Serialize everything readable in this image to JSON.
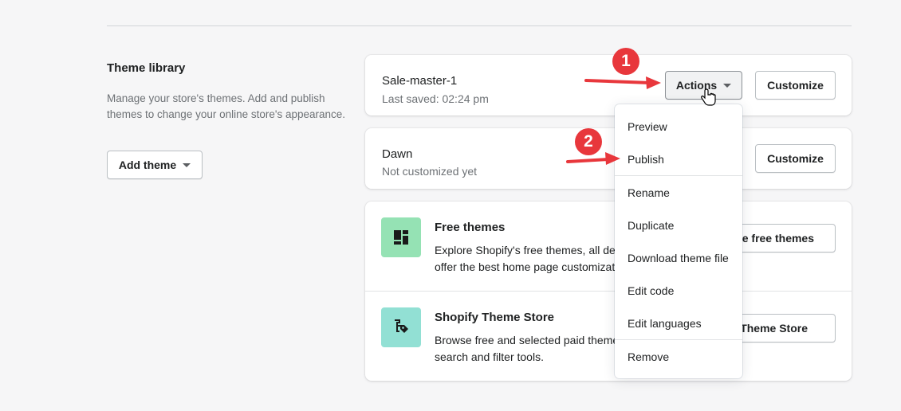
{
  "library": {
    "title": "Theme library",
    "description": "Manage your store's themes. Add and publish themes to change your online store's appearance.",
    "add_theme_label": "Add theme"
  },
  "themes": [
    {
      "name": "Sale-master-1",
      "status": "Last saved: 02:24 pm",
      "actions_label": "Actions",
      "customize_label": "Customize"
    },
    {
      "name": "Dawn",
      "status": "Not customized yet",
      "customize_label": "Customize"
    }
  ],
  "explore": [
    {
      "title": "Free themes",
      "description_lines": [
        "Explore Shopify's free themes, all des",
        "offer the best home page customizati"
      ],
      "button_label": "re free themes",
      "icon": "layout-icon",
      "color": "#95e2b4"
    },
    {
      "title": "Shopify Theme Store",
      "description_lines": [
        "Browse free and selected paid theme",
        "search and filter tools."
      ],
      "button_label": "Theme Store",
      "icon": "theme-store-icon",
      "color": "#92e0d4"
    }
  ],
  "actions_menu": {
    "items": [
      "Preview",
      "Publish",
      "Rename",
      "Duplicate",
      "Download theme file",
      "Edit code",
      "Edit languages",
      "Remove"
    ]
  },
  "annotations": {
    "badge_1": "1",
    "badge_2": "2",
    "color": "#e8373c"
  }
}
